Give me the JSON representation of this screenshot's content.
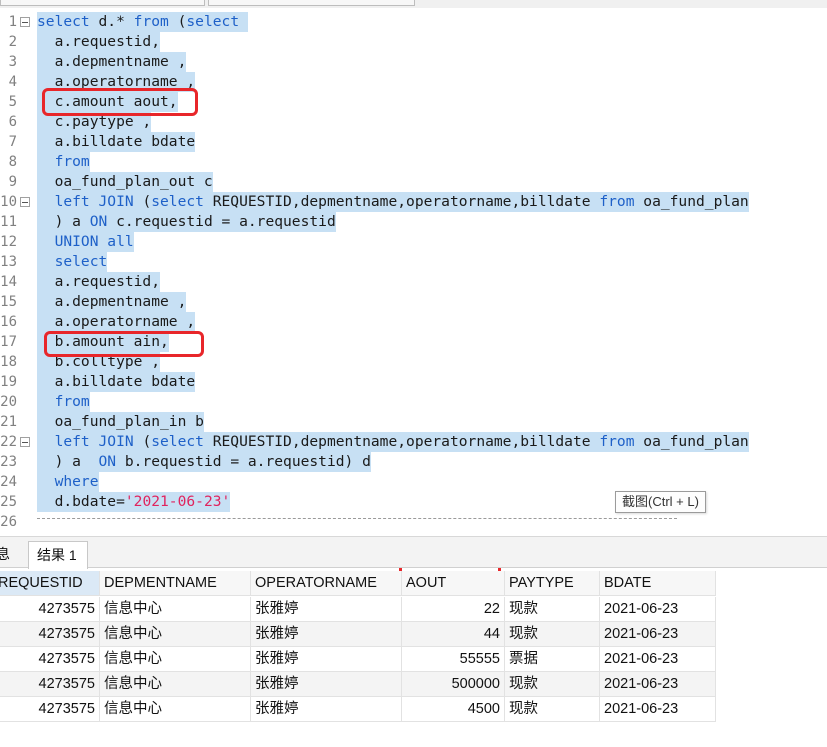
{
  "editor": {
    "lines": [
      {
        "n": "1",
        "fold": true,
        "tokens": [
          {
            "t": "select",
            "c": "kw"
          },
          {
            "t": " d.* ",
            "c": "plain"
          },
          {
            "t": "from",
            "c": "kw"
          },
          {
            "t": " (",
            "c": "plain"
          },
          {
            "t": "select",
            "c": "kw"
          },
          {
            "t": " ",
            "c": "plain"
          }
        ]
      },
      {
        "n": "2",
        "tokens": [
          {
            "t": "  a.requestid,",
            "c": "plain"
          }
        ]
      },
      {
        "n": "3",
        "tokens": [
          {
            "t": "  a.depmentname ,",
            "c": "plain"
          }
        ]
      },
      {
        "n": "4",
        "tokens": [
          {
            "t": "  a.operatorname ,",
            "c": "plain"
          }
        ]
      },
      {
        "n": "5",
        "tokens": [
          {
            "t": "  c.amount aout,",
            "c": "plain"
          }
        ]
      },
      {
        "n": "6",
        "tokens": [
          {
            "t": "  c.paytype ,",
            "c": "plain"
          }
        ]
      },
      {
        "n": "7",
        "tokens": [
          {
            "t": "  a.billdate bdate",
            "c": "plain"
          }
        ]
      },
      {
        "n": "8",
        "tokens": [
          {
            "t": "  ",
            "c": "plain"
          },
          {
            "t": "from",
            "c": "kw"
          }
        ]
      },
      {
        "n": "9",
        "tokens": [
          {
            "t": "  oa_fund_plan_out c",
            "c": "plain"
          }
        ]
      },
      {
        "n": "10",
        "fold": true,
        "tokens": [
          {
            "t": "  ",
            "c": "plain"
          },
          {
            "t": "left JOIN",
            "c": "kw"
          },
          {
            "t": " (",
            "c": "plain"
          },
          {
            "t": "select",
            "c": "kw"
          },
          {
            "t": " REQUESTID,depmentname,operatorname,billdate ",
            "c": "plain"
          },
          {
            "t": "from",
            "c": "kw"
          },
          {
            "t": " oa_fund_plan",
            "c": "plain"
          }
        ]
      },
      {
        "n": "11",
        "tokens": [
          {
            "t": "  ) a ",
            "c": "plain"
          },
          {
            "t": "ON",
            "c": "kw"
          },
          {
            "t": " c.requestid = a.requestid",
            "c": "plain"
          }
        ]
      },
      {
        "n": "12",
        "tokens": [
          {
            "t": "  ",
            "c": "plain"
          },
          {
            "t": "UNION all",
            "c": "kw"
          }
        ]
      },
      {
        "n": "13",
        "tokens": [
          {
            "t": "  ",
            "c": "plain"
          },
          {
            "t": "select",
            "c": "kw"
          }
        ]
      },
      {
        "n": "14",
        "tokens": [
          {
            "t": "  a.requestid,",
            "c": "plain"
          }
        ]
      },
      {
        "n": "15",
        "tokens": [
          {
            "t": "  a.depmentname ,",
            "c": "plain"
          }
        ]
      },
      {
        "n": "16",
        "tokens": [
          {
            "t": "  a.operatorname ,",
            "c": "plain"
          }
        ]
      },
      {
        "n": "17",
        "tokens": [
          {
            "t": "  b.amount ain,",
            "c": "plain"
          }
        ]
      },
      {
        "n": "18",
        "tokens": [
          {
            "t": "  b.colltype ,",
            "c": "plain"
          }
        ]
      },
      {
        "n": "19",
        "tokens": [
          {
            "t": "  a.billdate bdate",
            "c": "plain"
          }
        ]
      },
      {
        "n": "20",
        "tokens": [
          {
            "t": "  ",
            "c": "plain"
          },
          {
            "t": "from",
            "c": "kw"
          }
        ]
      },
      {
        "n": "21",
        "tokens": [
          {
            "t": "  oa_fund_plan_in b",
            "c": "plain"
          }
        ]
      },
      {
        "n": "22",
        "fold": true,
        "tokens": [
          {
            "t": "  ",
            "c": "plain"
          },
          {
            "t": "left JOIN",
            "c": "kw"
          },
          {
            "t": " (",
            "c": "plain"
          },
          {
            "t": "select",
            "c": "kw"
          },
          {
            "t": " REQUESTID,depmentname,operatorname,billdate ",
            "c": "plain"
          },
          {
            "t": "from",
            "c": "kw"
          },
          {
            "t": " oa_fund_plan",
            "c": "plain"
          }
        ]
      },
      {
        "n": "23",
        "tokens": [
          {
            "t": "  ) a  ",
            "c": "plain"
          },
          {
            "t": "ON",
            "c": "kw"
          },
          {
            "t": " b.requestid = a.requestid) d",
            "c": "plain"
          }
        ]
      },
      {
        "n": "24",
        "tokens": [
          {
            "t": "  ",
            "c": "plain"
          },
          {
            "t": "where",
            "c": "kw"
          }
        ]
      },
      {
        "n": "25",
        "tokens": [
          {
            "t": "  d.bdate=",
            "c": "plain"
          },
          {
            "t": "'2021-06-23'",
            "c": "str"
          }
        ]
      },
      {
        "n": "26",
        "tokens": []
      }
    ],
    "tooltip": "截图(Ctrl + L)"
  },
  "tabs": {
    "info_label": "息",
    "result_label": "结果 1"
  },
  "results": {
    "columns": [
      "REQUESTID",
      "DEPMENTNAME",
      "OPERATORNAME",
      "AOUT",
      "PAYTYPE",
      "BDATE"
    ],
    "rows": [
      [
        "4273575",
        "信息中心",
        "张雅婷",
        "22",
        "现款",
        "2021-06-23"
      ],
      [
        "4273575",
        "信息中心",
        "张雅婷",
        "44",
        "现款",
        "2021-06-23"
      ],
      [
        "4273575",
        "信息中心",
        "张雅婷",
        "55555",
        "票据",
        "2021-06-23"
      ],
      [
        "4273575",
        "信息中心",
        "张雅婷",
        "500000",
        "现款",
        "2021-06-23"
      ],
      [
        "4273575",
        "信息中心",
        "张雅婷",
        "4500",
        "现款",
        "2021-06-23"
      ]
    ]
  },
  "colors": {
    "selection": "#c7e0f4",
    "keyword": "#1e60c8",
    "string": "#e0245e",
    "annotation": "#e8262a"
  }
}
